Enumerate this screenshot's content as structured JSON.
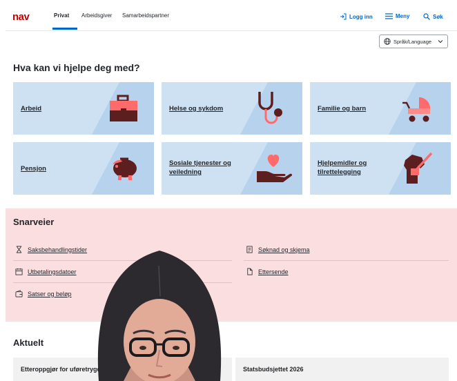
{
  "header": {
    "logo_text": "nav",
    "tabs": [
      "Privat",
      "Arbeidsgiver",
      "Samarbeidspartner"
    ],
    "login_label": "Logg inn",
    "menu_label": "Meny",
    "search_label": "Søk"
  },
  "language": {
    "label": "Språk/Language"
  },
  "main": {
    "heading": "Hva kan vi hjelpe deg med?",
    "cards": [
      {
        "label": "Arbeid",
        "icon": "briefcase-icon"
      },
      {
        "label": "Helse og sykdom",
        "icon": "stethoscope-icon"
      },
      {
        "label": "Familie og barn",
        "icon": "stroller-icon"
      },
      {
        "label": "Pensjon",
        "icon": "piggy-bank-icon"
      },
      {
        "label": "Sosiale tjenester og veiledning",
        "icon": "heart-hand-icon"
      },
      {
        "label": "Hjelpemidler og tilrettelegging",
        "icon": "service-dog-icon"
      }
    ]
  },
  "shortcuts": {
    "heading": "Snarveier",
    "items": [
      {
        "label": "Saksbehandlingstider",
        "icon": "hourglass-icon"
      },
      {
        "label": "Utbetalingsdatoer",
        "icon": "calendar-icon"
      },
      {
        "label": "Satser og beløp",
        "icon": "wallet-icon"
      },
      {
        "label": "Søknad og skjema",
        "icon": "form-icon"
      },
      {
        "label": "Ettersende",
        "icon": "document-icon"
      }
    ]
  },
  "news": {
    "heading": "Aktuelt",
    "items": [
      "Etteroppgjør for uføretrygd",
      "Statsbudsjettet 2026"
    ]
  },
  "colors": {
    "brand_red": "#c30000",
    "link_blue": "#0067c5",
    "card_bg": "#cde1f3",
    "shortcuts_bg": "#fbdedf"
  }
}
